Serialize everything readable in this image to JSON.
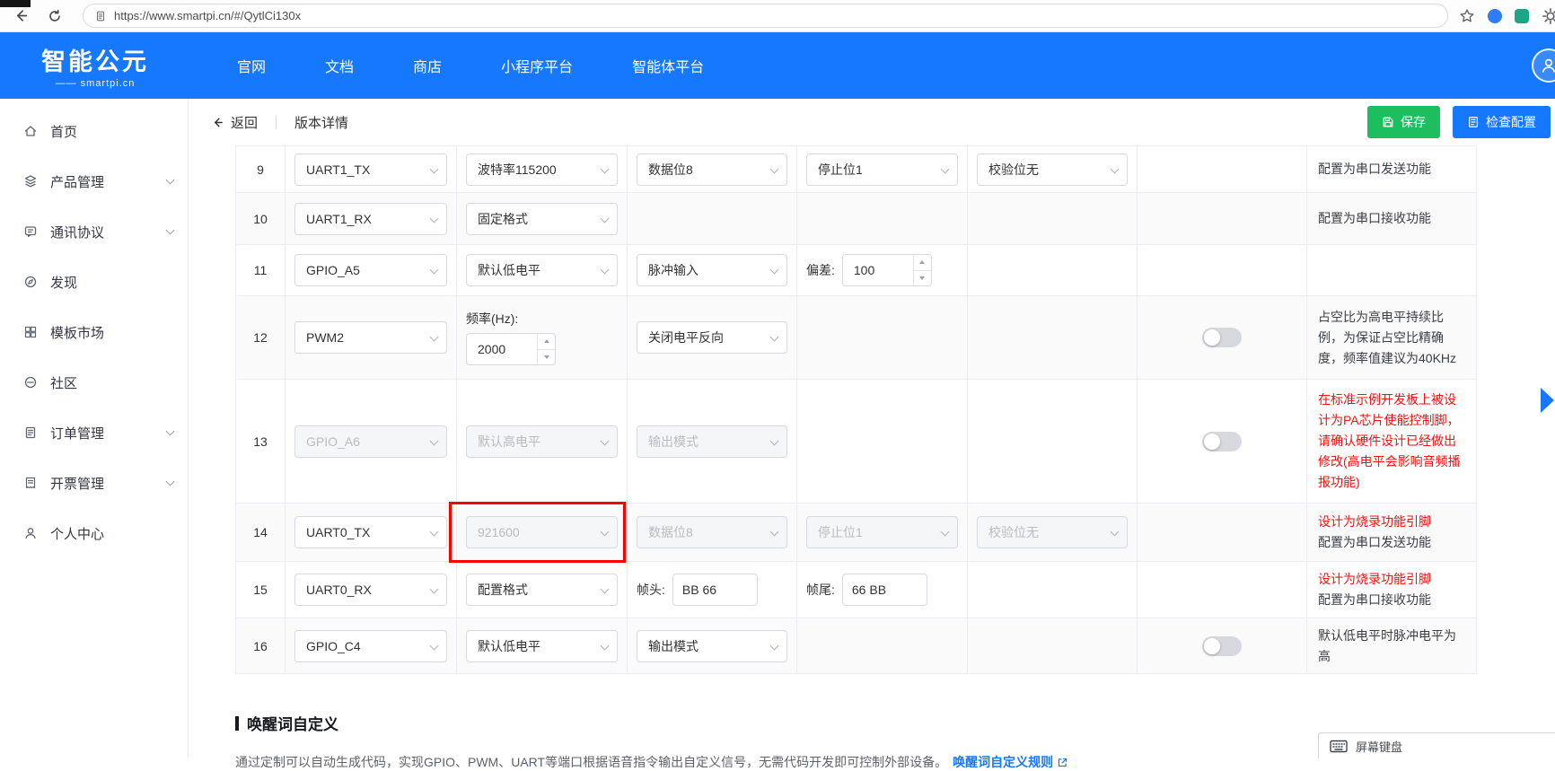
{
  "colors": {
    "header_blue": "#1677ff",
    "save_green": "#1cbe5e",
    "check_blue": "#1677ff",
    "alert_red": "#f21212",
    "highlight_red": "#fd0000",
    "link_blue": "#1677ff"
  },
  "browser": {
    "url": "https://www.smartpi.cn/#/QytlCi130x"
  },
  "header": {
    "logo_title": "智能公元",
    "logo_subtitle": "—— smartpi.cn",
    "nav": [
      {
        "label": "官网"
      },
      {
        "label": "文档"
      },
      {
        "label": "商店"
      },
      {
        "label": "小程序平台"
      },
      {
        "label": "智能体平台"
      }
    ]
  },
  "sidebar": {
    "collapse_label": "«",
    "items": [
      {
        "label": "首页"
      },
      {
        "label": "产品管理"
      },
      {
        "label": "通讯协议"
      },
      {
        "label": "发现"
      },
      {
        "label": "模板市场"
      },
      {
        "label": "社区"
      },
      {
        "label": "订单管理"
      },
      {
        "label": "开票管理"
      },
      {
        "label": "个人中心"
      }
    ]
  },
  "toolbar": {
    "back_label": "返回",
    "title": "版本详情",
    "save_label": "保存",
    "check_label": "检查配置"
  },
  "table": {
    "rows": [
      {
        "num": "9",
        "pin": "UART1_TX",
        "sel2": "波特率115200",
        "sel3": "数据位8",
        "sel4": "停止位1",
        "sel5": "校验位无",
        "desc": "配置为串口发送功能"
      },
      {
        "num": "10",
        "pin": "UART1_RX",
        "sel2": "固定格式",
        "desc": "配置为串口接收功能"
      },
      {
        "num": "11",
        "pin": "GPIO_A5",
        "sel2": "默认低电平",
        "sel3": "脉冲输入",
        "offset_label": "偏差:",
        "offset_value": "100"
      },
      {
        "num": "12",
        "pin": "PWM2",
        "freq_label": "频率(Hz):",
        "freq_value": "2000",
        "sel3": "关闭电平反向",
        "toggle": "off",
        "desc": "占空比为高电平持续比例，为保证占空比精确度，频率值建议为40KHz"
      },
      {
        "num": "13",
        "pin": "GPIO_A6",
        "sel2": "默认高电平",
        "sel3": "输出模式",
        "toggle": "off",
        "desc_red": "在标准示例开发板上被设计为PA芯片使能控制脚，请确认硬件设计已经做出修改(高电平会影响音频播报功能)"
      },
      {
        "num": "14",
        "pin": "UART0_TX",
        "sel2": "921600",
        "sel3": "数据位8",
        "sel4": "停止位1",
        "sel5": "校验位无",
        "desc_red": "设计为烧录功能引脚",
        "desc": "配置为串口发送功能"
      },
      {
        "num": "15",
        "pin": "UART0_RX",
        "sel2": "配置格式",
        "head_label": "帧头:",
        "head_value": "BB 66",
        "tail_label": "帧尾:",
        "tail_value": "66 BB",
        "desc_red": "设计为烧录功能引脚",
        "desc": "配置为串口接收功能"
      },
      {
        "num": "16",
        "pin": "GPIO_C4",
        "sel2": "默认低电平",
        "sel3": "输出模式",
        "toggle": "off",
        "desc": "默认低电平时脉冲电平为高"
      }
    ]
  },
  "wake_section": {
    "title": "唤醒词自定义",
    "description": "通过定制可以自动生成代码，实现GPIO、PWM、UART等端口根据语音指令输出自定义信号，无需代码开发即可控制外部设备。",
    "link_label": "唤醒词自定义规则"
  },
  "keyboard_widget": {
    "label": "屏幕键盘"
  }
}
